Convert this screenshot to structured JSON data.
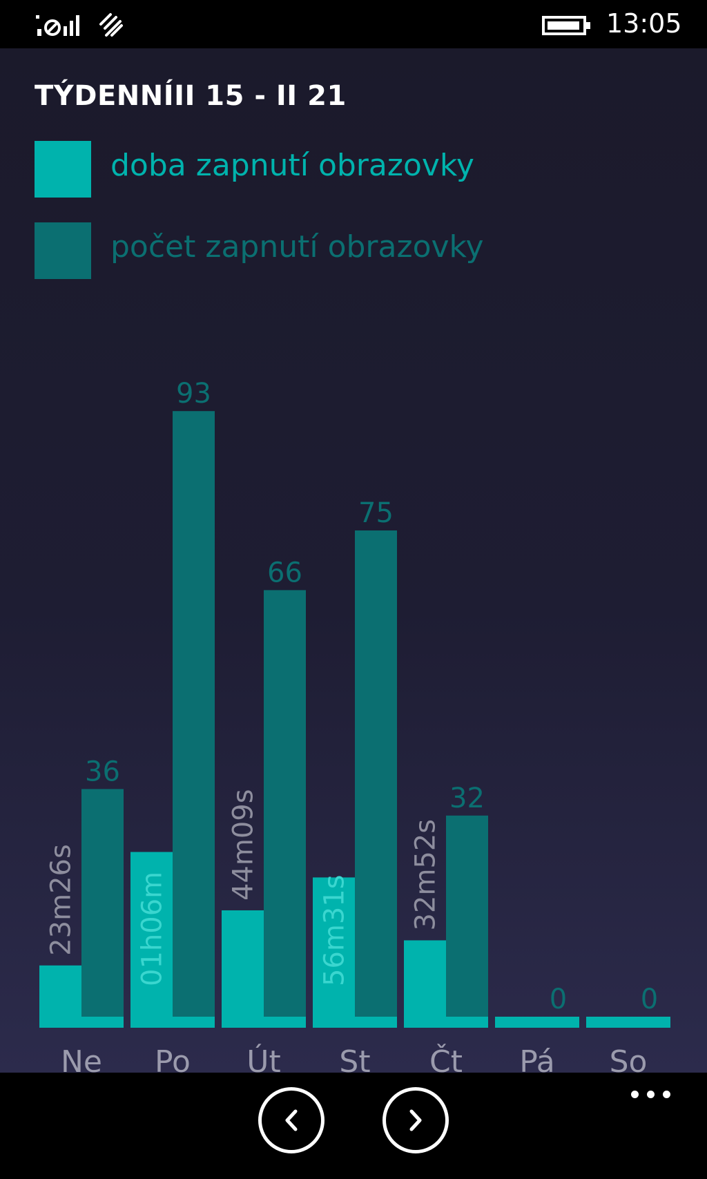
{
  "status_bar": {
    "time": "13:05",
    "icons": [
      "signal-icon",
      "data-connection-icon",
      "battery-icon"
    ]
  },
  "page": {
    "title": "TÝDENNÍII 15 - II 21"
  },
  "legend": [
    {
      "label": "doba zapnutí obrazovky",
      "color": "#00b3ad"
    },
    {
      "label": "počet zapnutí obrazovky",
      "color": "#0b6f71"
    }
  ],
  "chart_data": {
    "type": "bar",
    "categories": [
      "Ne",
      "Po",
      "Út",
      "St",
      "Čt",
      "Pá",
      "So"
    ],
    "series": [
      {
        "name": "doba zapnutí obrazovky",
        "color": "#00b3ad",
        "values_minutes": [
          23.43,
          66.1,
          44.15,
          56.52,
          32.87,
          0,
          0
        ],
        "labels": [
          "23m26s",
          "01h06m",
          "44m09s",
          "56m31s",
          "32m52s",
          "",
          ""
        ]
      },
      {
        "name": "počet zapnutí obrazovky",
        "color": "#0b6f71",
        "values": [
          36,
          93,
          66,
          75,
          32,
          0,
          0
        ],
        "labels": [
          "36",
          "93",
          "66",
          "75",
          "32",
          "0",
          "0"
        ]
      }
    ]
  },
  "app_bar": {
    "icons": [
      "chevron-left-icon",
      "chevron-right-icon",
      "more-icon"
    ]
  }
}
